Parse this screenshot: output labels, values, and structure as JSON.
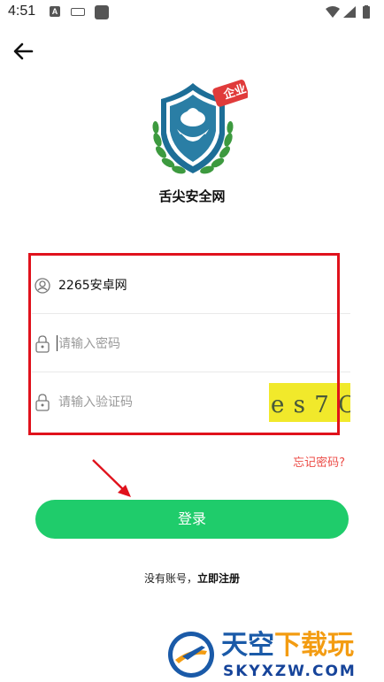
{
  "status_bar": {
    "time": "4:51",
    "notification_letter": "A"
  },
  "header": {
    "app_name": "舌尖安全网",
    "badge": "企业"
  },
  "form": {
    "username_value": "2265安卓网",
    "password_placeholder": "请输入密码",
    "captcha_placeholder": "请输入验证码",
    "captcha_code": "e s 7 C",
    "forgot_label": "忘记密码?"
  },
  "actions": {
    "login_label": "登录",
    "no_account_label": "没有账号，",
    "register_label": "立即注册"
  },
  "watermark": {
    "title_part1": "天空",
    "title_part2": "下载玩",
    "subtitle": "SKYXZW.COM"
  },
  "colors": {
    "accent_green": "#1fcc6b",
    "forgot_red": "#ec4b46",
    "highlight_red": "#e0121c",
    "captcha_bg": "#f1e92b"
  }
}
